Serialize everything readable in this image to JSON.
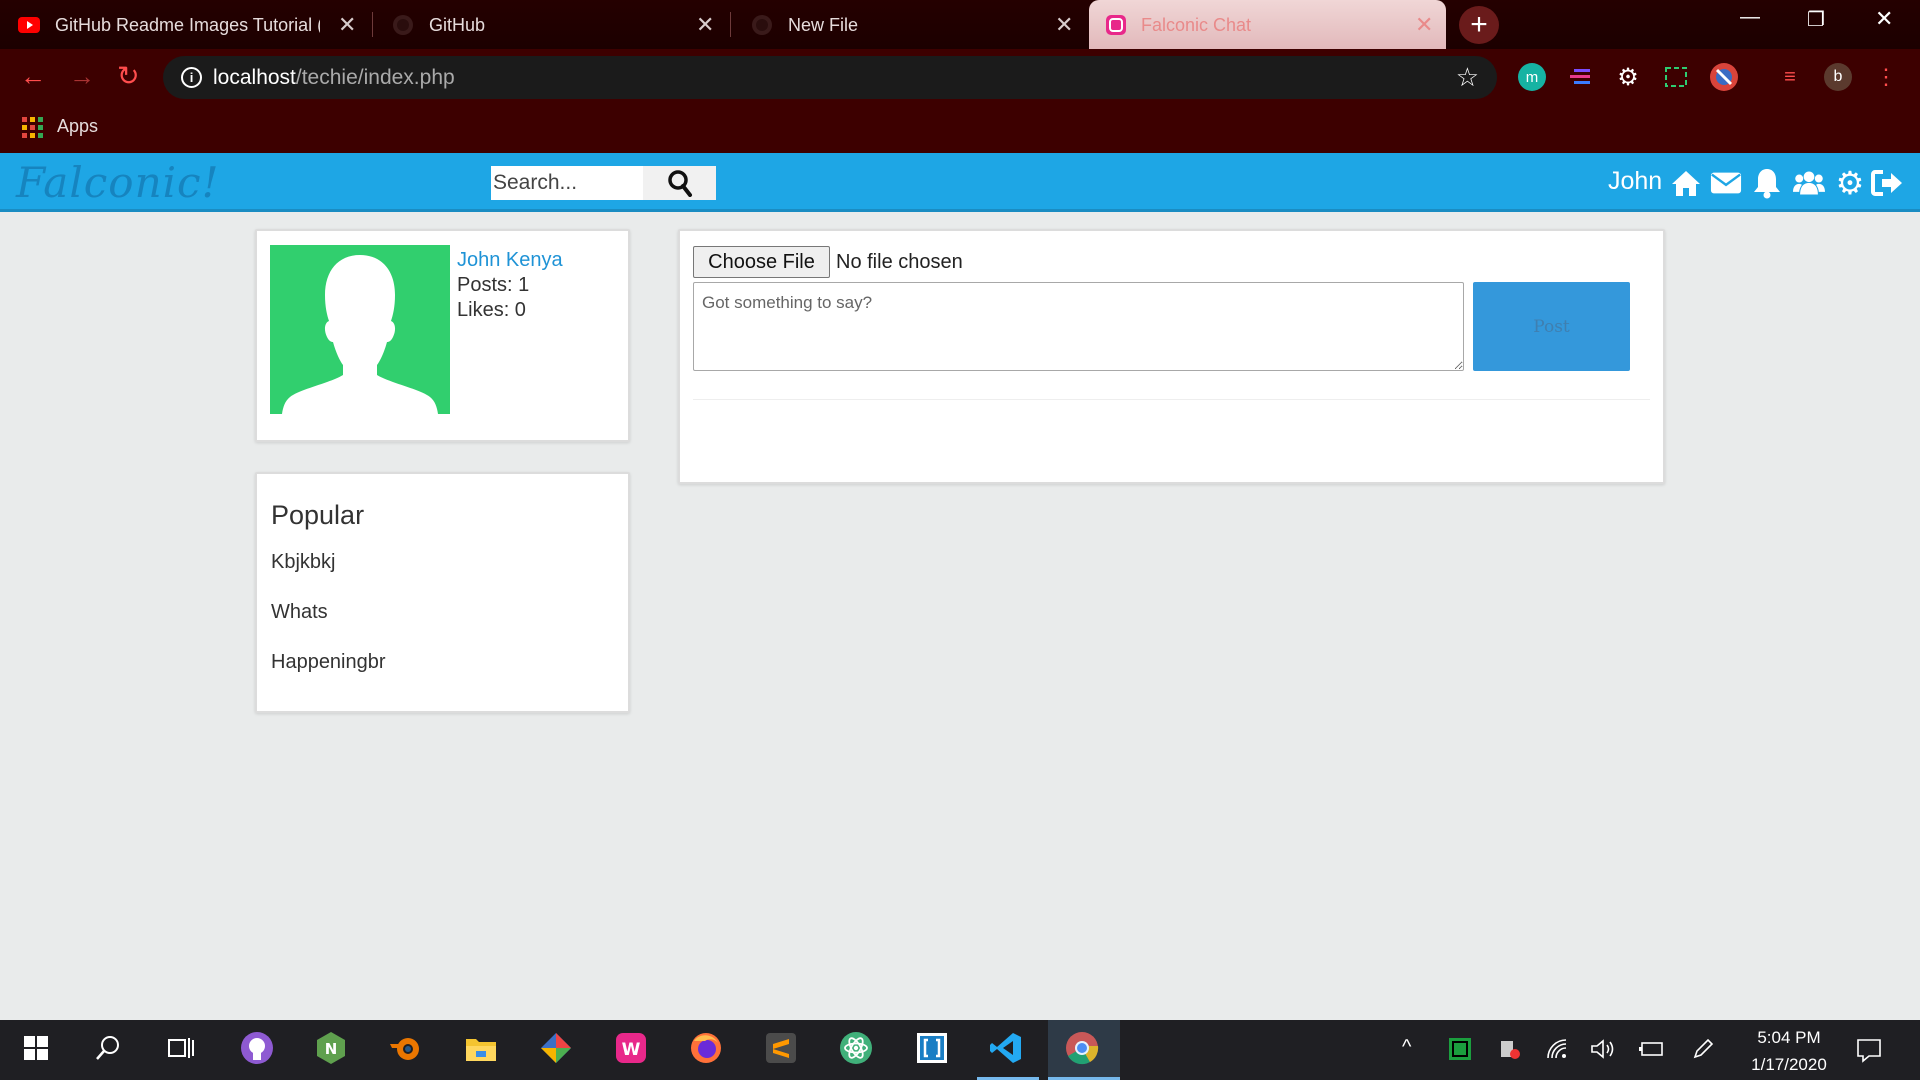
{
  "browser": {
    "tabs": [
      {
        "title": "GitHub Readme Images Tutorial (",
        "icon": "youtube-icon"
      },
      {
        "title": "GitHub",
        "icon": "github-icon"
      },
      {
        "title": "New File",
        "icon": "github-icon"
      },
      {
        "title": "Falconic Chat",
        "icon": "falconic-icon",
        "active": true
      }
    ],
    "new_tab_label": "+",
    "url_host": "localhost",
    "url_path": "/techie/index.php",
    "profile_initial": "b",
    "bookmarks_apps": "Apps",
    "colors": {
      "frame": "#250000",
      "toolbar": "#3d0000",
      "active_tab": "#f0d6d6",
      "accent": "#ff4d4d"
    }
  },
  "site": {
    "logo": "Falconic!",
    "search_placeholder": "Search...",
    "username": "John",
    "nav_icons": [
      "home-icon",
      "mail-icon",
      "bell-icon",
      "users-icon",
      "gear-icon",
      "logout-icon"
    ],
    "colors": {
      "header": "#1ea6e5",
      "logo": "#1684bf",
      "link": "#1f93d6",
      "avatar_bg": "#31cf6e",
      "post_button": "#3498db",
      "page_bg": "#e9ebeb"
    }
  },
  "profile": {
    "name": "John Kenya",
    "posts": "Posts: 1",
    "likes": "Likes: 0"
  },
  "popular": {
    "title": "Popular",
    "items": [
      "Kbjkbkj",
      "Whats",
      "Happeningbr"
    ]
  },
  "composer": {
    "file_button": "Choose File",
    "file_status": "No file chosen",
    "placeholder": "Got something to say?",
    "post_button": "Post"
  },
  "taskbar": {
    "apps": [
      "windows-start-icon",
      "search-icon",
      "task-view-icon",
      "github-desktop-icon",
      "node-icon",
      "blender-icon",
      "file-explorer-icon",
      "git-icon",
      "falconic-icon",
      "firefox-icon",
      "sublime-text-icon",
      "atom-icon",
      "brackets-icon",
      "vscode-icon",
      "chrome-icon"
    ],
    "time": "5:04 PM",
    "date": "1/17/2020"
  }
}
